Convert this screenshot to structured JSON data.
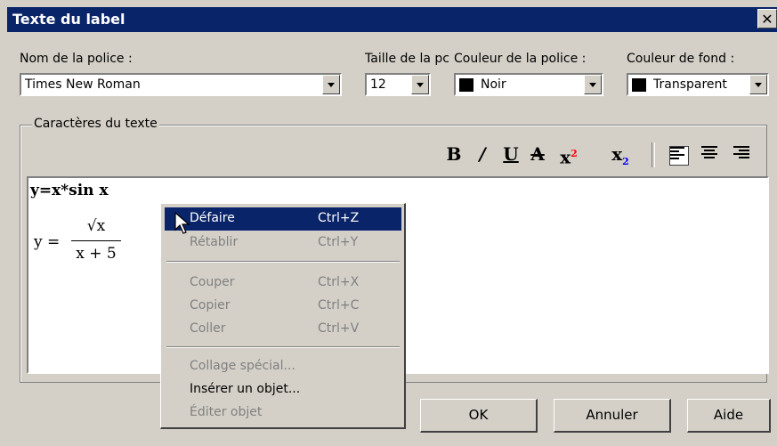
{
  "window": {
    "title": "Texte du label",
    "close_glyph": "✕"
  },
  "font": {
    "name_label": "Nom de la police :",
    "name_value": "Times New Roman",
    "size_label": "Taille de la pc",
    "size_value": "12",
    "color_label": "Couleur de la police :",
    "color_value": "Noir",
    "bg_label": "Couleur de fond :",
    "bg_value": "Transparent"
  },
  "group": {
    "label": "Caractères du texte"
  },
  "toolbar": {
    "bold": "B",
    "italic": "/",
    "underline": "U",
    "strike": "A",
    "superscript_base": "x",
    "superscript_exp": "2",
    "subscript_base": "x",
    "subscript_exp": "2"
  },
  "editor": {
    "line1": "y=x*sin x",
    "formula_lhs": "y =",
    "formula_numerator": "√x",
    "formula_denominator": "x + 5"
  },
  "menu": {
    "items": [
      {
        "label": "Défaire",
        "shortcut": "Ctrl+Z"
      },
      {
        "label": "Rétablir",
        "shortcut": "Ctrl+Y"
      },
      {
        "label": "Couper",
        "shortcut": "Ctrl+X"
      },
      {
        "label": "Copier",
        "shortcut": "Ctrl+C"
      },
      {
        "label": "Coller",
        "shortcut": "Ctrl+V"
      },
      {
        "label": "Collage spécial...",
        "shortcut": ""
      },
      {
        "label": "Insérer un objet...",
        "shortcut": ""
      },
      {
        "label": "Éditer objet",
        "shortcut": ""
      }
    ]
  },
  "buttons": {
    "ok": "OK",
    "cancel": "Annuler",
    "help": "Aide"
  },
  "colors": {
    "titlebar": "#0a246a",
    "face": "#d4d0c8",
    "superscript": "#ff0000",
    "subscript": "#0000ff"
  },
  "icons": [
    "close-icon",
    "dropdown-arrow-icon",
    "bold-icon",
    "italic-icon",
    "underline-icon",
    "strikethrough-icon",
    "superscript-icon",
    "subscript-icon",
    "align-left-icon",
    "align-center-icon",
    "align-right-icon",
    "mouse-cursor-icon"
  ]
}
